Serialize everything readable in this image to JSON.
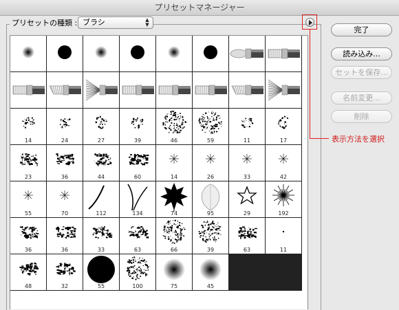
{
  "window": {
    "title": "プリセットマネージャー"
  },
  "preset_type": {
    "label": "プリセットの種類 :",
    "selected": "ブラシ"
  },
  "menu_button": {
    "icon": "circle-arrow-right-icon"
  },
  "callout": {
    "text": "表示方法を選択",
    "color": "#d01818"
  },
  "buttons": {
    "done": {
      "label": "完了",
      "enabled": true
    },
    "load": {
      "label": "読み込み...",
      "enabled": true
    },
    "save_set": {
      "label": "セットを保存...",
      "enabled": false
    },
    "rename": {
      "label": "名前変更...",
      "enabled": false
    },
    "delete": {
      "label": "削除",
      "enabled": false
    }
  },
  "brushes": [
    {
      "kind": "soft",
      "size": ""
    },
    {
      "kind": "hard",
      "size": ""
    },
    {
      "kind": "soft",
      "size": ""
    },
    {
      "kind": "hard",
      "size": ""
    },
    {
      "kind": "soft",
      "size": ""
    },
    {
      "kind": "hard",
      "size": ""
    },
    {
      "kind": "brush-round",
      "size": ""
    },
    {
      "kind": "brush-flat",
      "size": ""
    },
    {
      "kind": "brush-flat",
      "size": ""
    },
    {
      "kind": "brush-angled",
      "size": ""
    },
    {
      "kind": "brush-fan",
      "size": ""
    },
    {
      "kind": "brush-flat",
      "size": ""
    },
    {
      "kind": "brush-flat",
      "size": ""
    },
    {
      "kind": "brush-flat",
      "size": ""
    },
    {
      "kind": "brush-angled",
      "size": ""
    },
    {
      "kind": "brush-fan",
      "size": ""
    },
    {
      "kind": "spatter",
      "size": "14"
    },
    {
      "kind": "spatter",
      "size": "24"
    },
    {
      "kind": "spatter",
      "size": "27"
    },
    {
      "kind": "spatter",
      "size": "39"
    },
    {
      "kind": "spatter-big",
      "size": "46"
    },
    {
      "kind": "spatter-big",
      "size": "59"
    },
    {
      "kind": "spatter",
      "size": "11"
    },
    {
      "kind": "spatter",
      "size": "17"
    },
    {
      "kind": "chalk",
      "size": "23"
    },
    {
      "kind": "chalk",
      "size": "36"
    },
    {
      "kind": "chalk",
      "size": "44"
    },
    {
      "kind": "chalk",
      "size": "60"
    },
    {
      "kind": "star-small",
      "size": "14"
    },
    {
      "kind": "star-small",
      "size": "26"
    },
    {
      "kind": "star-small",
      "size": "33"
    },
    {
      "kind": "star-small",
      "size": "42"
    },
    {
      "kind": "star-small",
      "size": "55"
    },
    {
      "kind": "star-small",
      "size": "70"
    },
    {
      "kind": "grass-one",
      "size": "112"
    },
    {
      "kind": "grass-two",
      "size": "134"
    },
    {
      "kind": "leaf-maple",
      "size": "74"
    },
    {
      "kind": "leaf-light",
      "size": "95"
    },
    {
      "kind": "star-outline",
      "size": "29"
    },
    {
      "kind": "starburst",
      "size": "192"
    },
    {
      "kind": "chalk",
      "size": "36"
    },
    {
      "kind": "chalk",
      "size": "36"
    },
    {
      "kind": "chalk",
      "size": "33"
    },
    {
      "kind": "chalk",
      "size": "63"
    },
    {
      "kind": "spatter-big",
      "size": "66"
    },
    {
      "kind": "spatter-big",
      "size": "39"
    },
    {
      "kind": "chalk",
      "size": "63"
    },
    {
      "kind": "dot-tiny",
      "size": "11"
    },
    {
      "kind": "chalk",
      "size": "48"
    },
    {
      "kind": "chalk",
      "size": "32"
    },
    {
      "kind": "hard-big",
      "size": "55"
    },
    {
      "kind": "spatter-big",
      "size": "100"
    },
    {
      "kind": "soft-big",
      "size": "75"
    },
    {
      "kind": "soft-big",
      "size": "45"
    }
  ]
}
